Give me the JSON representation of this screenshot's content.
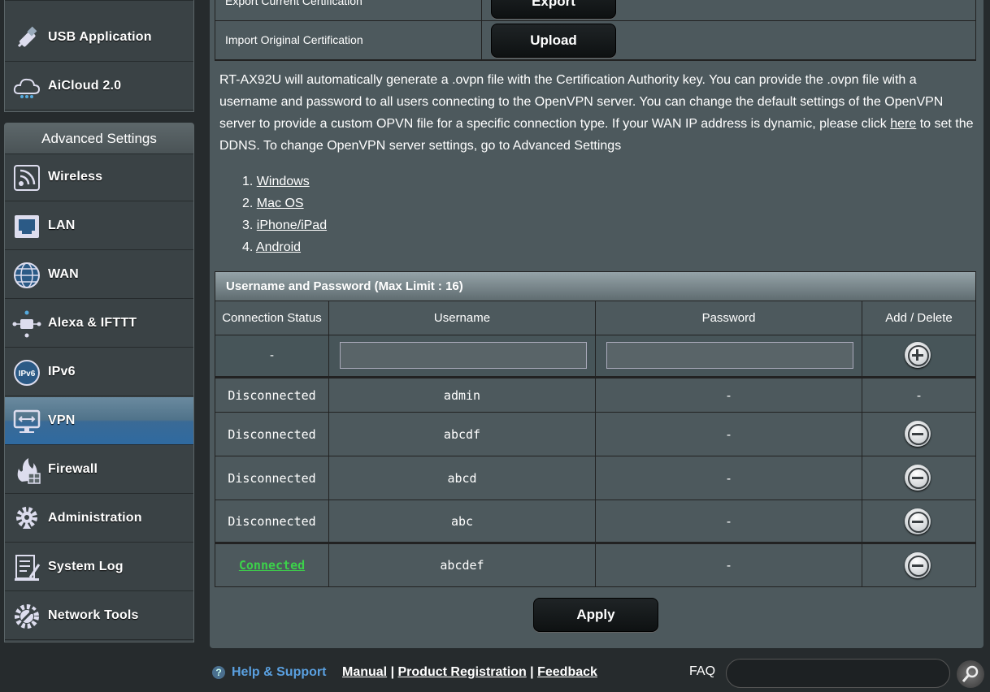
{
  "sidebar": {
    "general_items": [
      {
        "label": "USB Application",
        "icon": "usb-icon"
      },
      {
        "label": "AiCloud 2.0",
        "icon": "cloud-icon"
      }
    ],
    "advanced_title": "Advanced Settings",
    "advanced_items": [
      {
        "label": "Wireless",
        "icon": "wireless-icon"
      },
      {
        "label": "LAN",
        "icon": "lan-icon"
      },
      {
        "label": "WAN",
        "icon": "globe-icon"
      },
      {
        "label": "Alexa & IFTTT",
        "icon": "alexa-icon"
      },
      {
        "label": "IPv6",
        "icon": "ipv6-icon"
      },
      {
        "label": "VPN",
        "icon": "vpn-icon"
      },
      {
        "label": "Firewall",
        "icon": "firewall-icon"
      },
      {
        "label": "Administration",
        "icon": "gear-icon"
      },
      {
        "label": "System Log",
        "icon": "log-icon"
      },
      {
        "label": "Network Tools",
        "icon": "tools-icon"
      }
    ],
    "active": "VPN"
  },
  "cert": {
    "export_label": "Export Current Certification",
    "export_button": "Export",
    "import_label": "Import Original Certification",
    "import_button": "Upload"
  },
  "description": {
    "text_before_link": "RT-AX92U will automatically generate a .ovpn file with the Certification Authority key. You can provide the .ovpn file with a username and password to all users connecting to the OpenVPN server. You can change the default settings of the OpenVPN server to provide a custom OPVN file for a specific connection type. If your WAN IP address is dynamic, please click ",
    "link": "here",
    "text_after_link": " to set the DDNS. To change OpenVPN server settings, go to Advanced Settings"
  },
  "os_links": [
    "Windows",
    "Mac OS",
    "iPhone/iPad",
    "Android"
  ],
  "users": {
    "title": "Username and Password (Max Limit : 16)",
    "columns": [
      "Connection Status",
      "Username",
      "Password",
      "Add / Delete"
    ],
    "input_status": "-",
    "rows": [
      {
        "status": "Disconnected",
        "username": "admin",
        "password": "-",
        "action": "-"
      },
      {
        "status": "Disconnected",
        "username": "abcdf",
        "password": "-",
        "action": "delete"
      },
      {
        "status": "Disconnected",
        "username": "abcd",
        "password": "-",
        "action": "delete"
      },
      {
        "status": "Disconnected",
        "username": "abc",
        "password": "-",
        "action": "delete"
      },
      {
        "status": "Connected",
        "username": "abcdef",
        "password": "-",
        "action": "delete"
      }
    ]
  },
  "apply_label": "Apply",
  "footer": {
    "help": "Help & Support",
    "manual": "Manual",
    "registration": "Product Registration",
    "feedback": "Feedback",
    "faq": "FAQ"
  },
  "colors": {
    "connected": "#3cd14a",
    "active_nav": "#2f6aa0",
    "panel": "#4d595d"
  }
}
